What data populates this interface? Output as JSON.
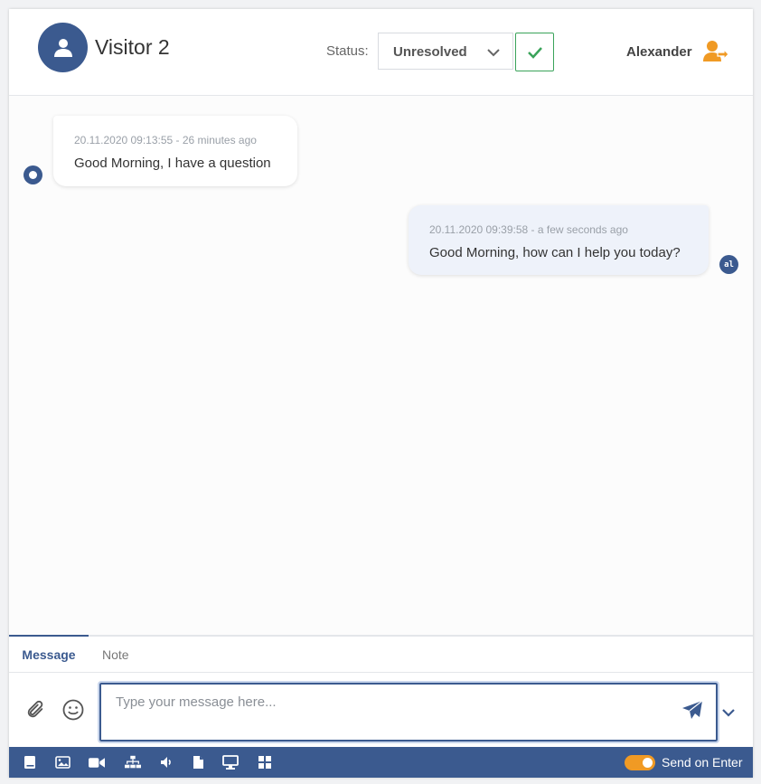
{
  "header": {
    "visitor_name": "Visitor 2",
    "status_label": "Status:",
    "status_value": "Unresolved",
    "agent_name": "Alexander"
  },
  "messages": [
    {
      "sender": "visitor",
      "meta": "20.11.2020 09:13:55 - 26 minutes ago",
      "text": "Good Morning, I have a question"
    },
    {
      "sender": "agent",
      "meta": "20.11.2020 09:39:58 - a few seconds ago",
      "text": "Good Morning, how can I help you today?",
      "avatar_initials": "al"
    }
  ],
  "composer": {
    "tabs": [
      {
        "label": "Message",
        "active": true
      },
      {
        "label": "Note",
        "active": false
      }
    ],
    "placeholder": "Type your message here..."
  },
  "toolbar": {
    "icons": [
      "book-icon",
      "image-icon",
      "video-icon",
      "sitemap-icon",
      "volume-icon",
      "file-icon",
      "monitor-icon",
      "grid-icon"
    ],
    "send_on_enter_label": "Send on Enter",
    "send_on_enter": true
  },
  "colors": {
    "brand": "#3b5a8f",
    "accent": "#f09a24",
    "success": "#3aa35a"
  }
}
